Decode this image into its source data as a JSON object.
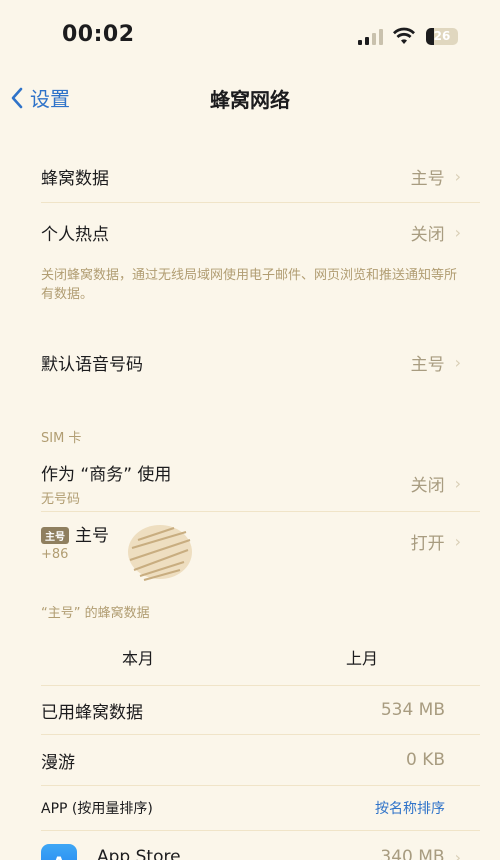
{
  "status": {
    "time": "00:02",
    "battery": "26"
  },
  "nav": {
    "back_label": "设置",
    "title": "蜂窝网络"
  },
  "rows": {
    "cellular_data": {
      "label": "蜂窝数据",
      "value": "主号"
    },
    "hotspot": {
      "label": "个人热点",
      "value": "关闭"
    },
    "hotspot_note": "关闭蜂窝数据，通过无线局域网使用电子邮件、网页浏览和推送通知等所有数据。",
    "default_voice": {
      "label": "默认语音号码",
      "value": "主号"
    }
  },
  "sim": {
    "section_title": "SIM 卡",
    "business": {
      "label": "作为 “商务” 使用",
      "sub": "无号码",
      "value": "关闭"
    },
    "primary": {
      "badge": "主号",
      "label": "主号",
      "sub": "+86",
      "value": "打开"
    }
  },
  "usage": {
    "section_title": "“主号” 的蜂窝数据",
    "tabs": [
      "本月",
      "上月"
    ],
    "used": {
      "label": "已用蜂窝数据",
      "value": "534 MB"
    },
    "roaming": {
      "label": "漫游",
      "value": "0 KB"
    }
  },
  "apps": {
    "header": "APP (按用量排序)",
    "sort_link": "按名称排序",
    "items": [
      {
        "name": "App Store",
        "value": "340 MB"
      }
    ]
  },
  "icons": {
    "back": "chevron-left-icon",
    "row_chevron": "chevron-right-icon",
    "signal": "cellular-signal-icon",
    "wifi": "wifi-icon",
    "battery": "battery-icon",
    "app_store": "app-store-icon"
  },
  "colors": {
    "accent": "#2f73c9",
    "secondary_text": "#a89c80",
    "background": "#fbf6ea"
  }
}
